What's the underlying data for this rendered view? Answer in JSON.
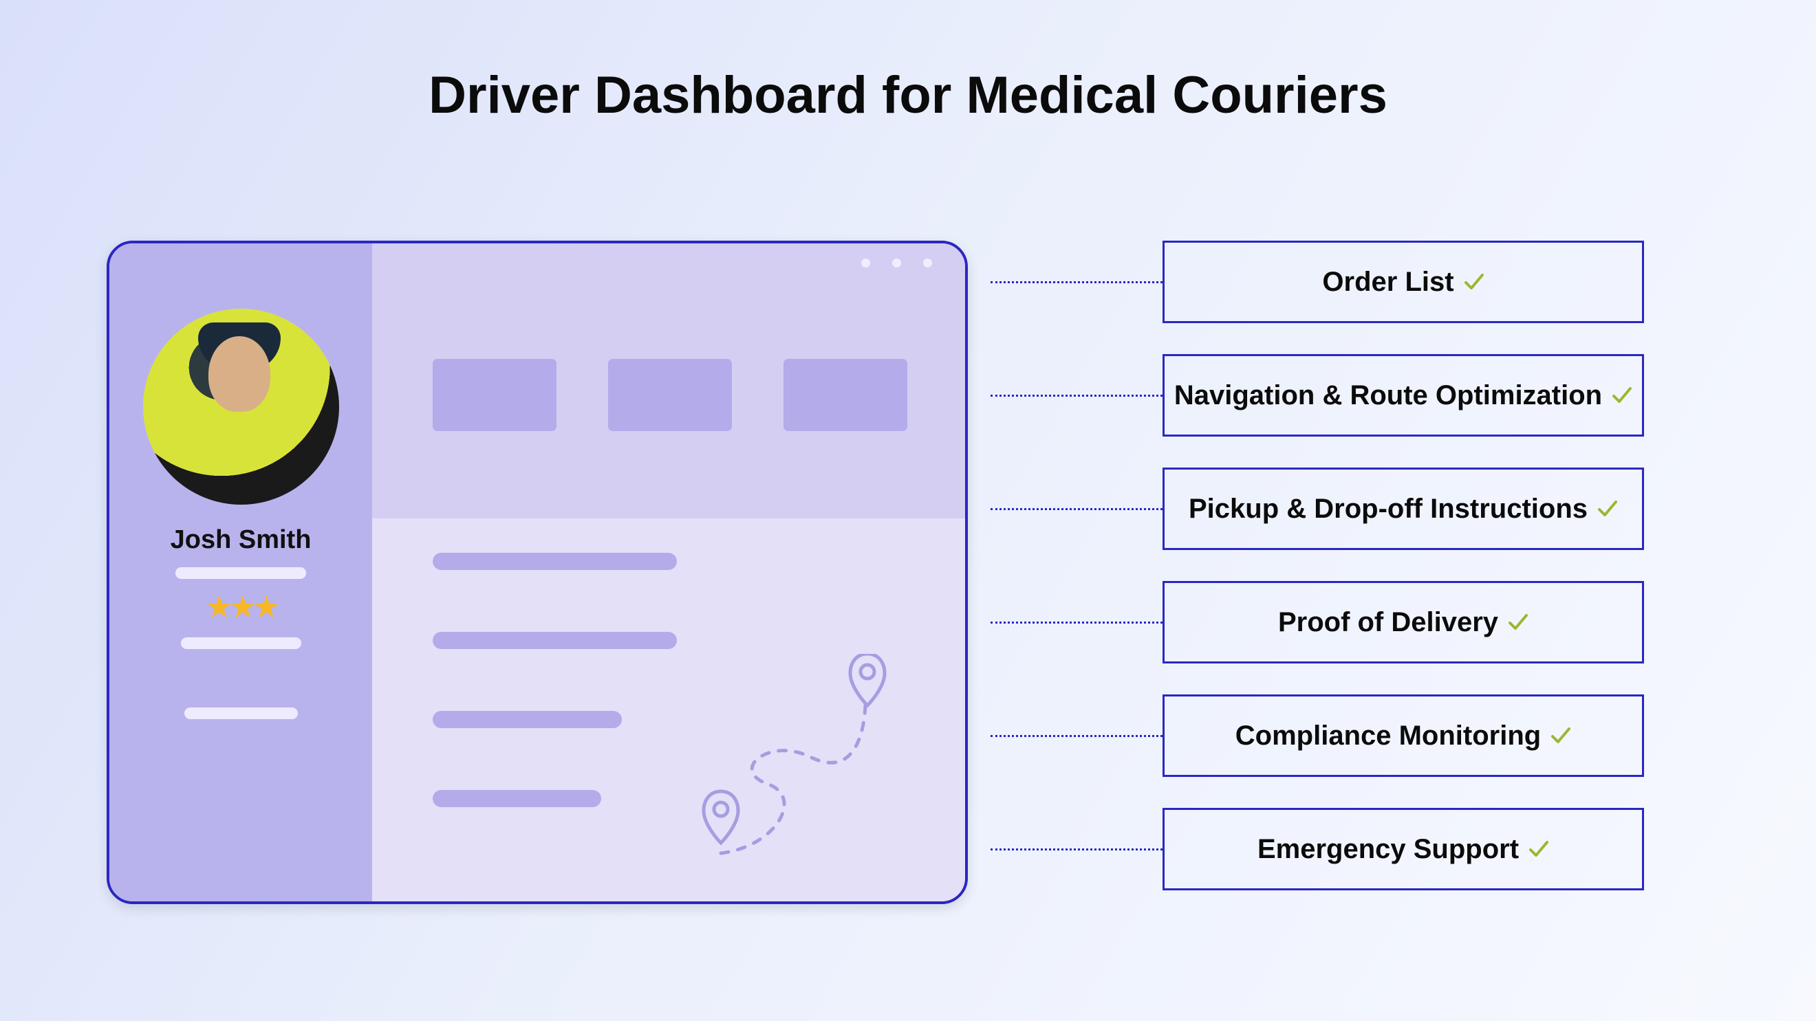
{
  "title": "Driver Dashboard for Medical Couriers",
  "driver": {
    "name": "Josh Smith",
    "rating_stars": "★★★"
  },
  "features": [
    {
      "label": "Order List"
    },
    {
      "label": "Navigation & Route Optimization"
    },
    {
      "label": "Pickup & Drop-off Instructions"
    },
    {
      "label": "Proof of Delivery"
    },
    {
      "label": "Compliance Monitoring"
    },
    {
      "label": "Emergency Support"
    }
  ]
}
